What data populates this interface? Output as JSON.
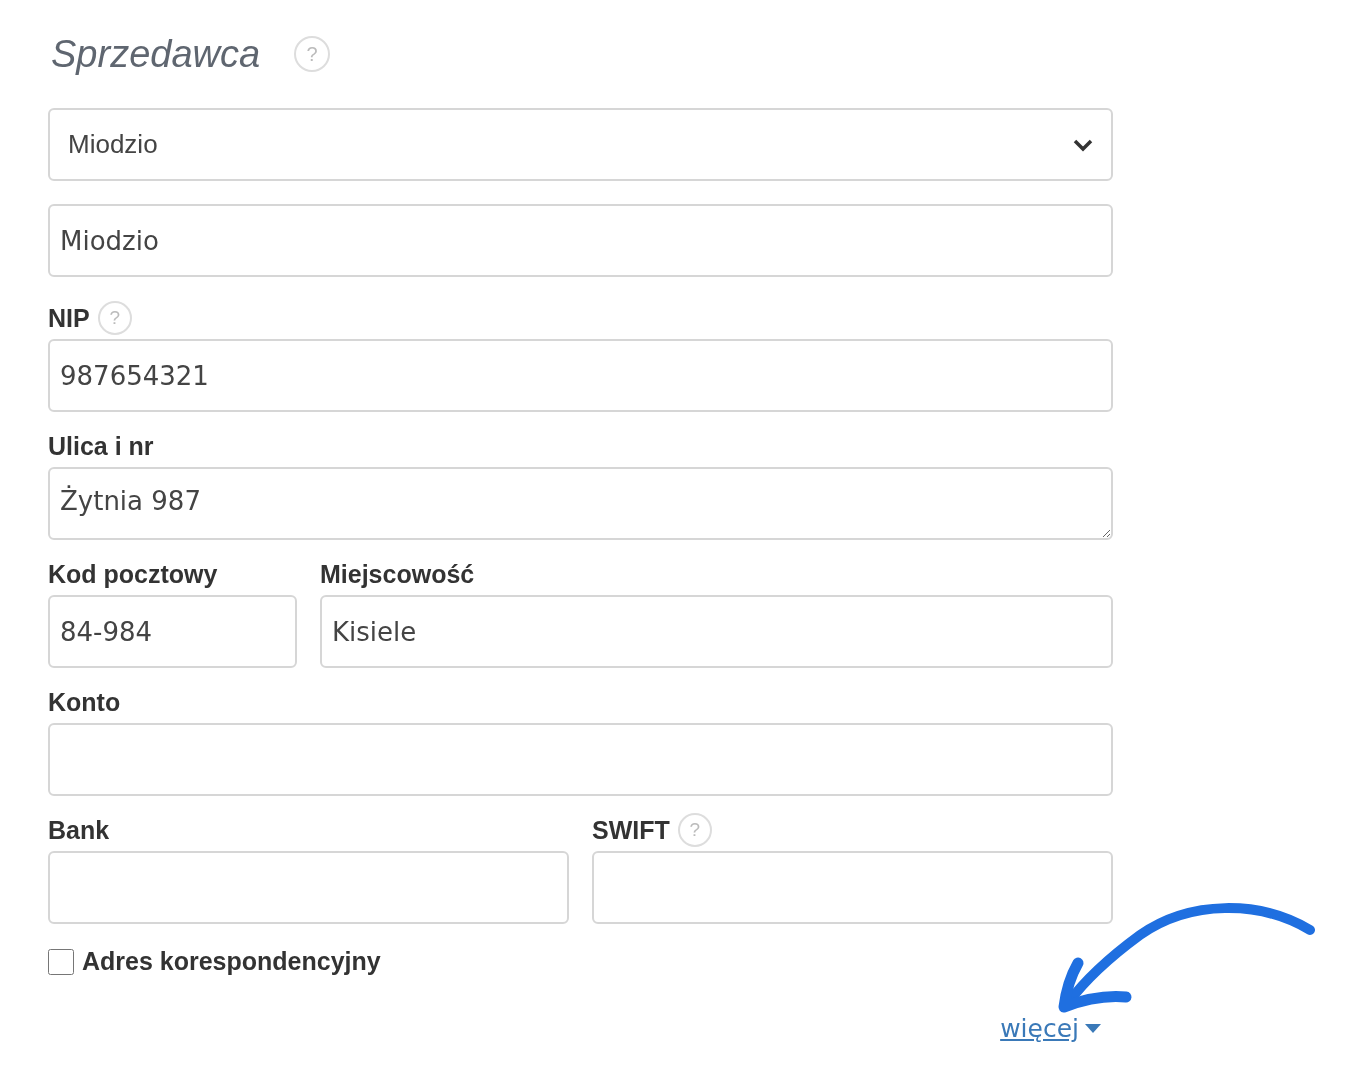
{
  "title": {
    "text": "Sprzedawca",
    "help": "?"
  },
  "seller_select": {
    "value": "Miodzio"
  },
  "name_field": {
    "value": "Miodzio"
  },
  "rows": [
    [
      {
        "label": "NIP",
        "help": "?",
        "kind": "input",
        "value": "987654321"
      }
    ],
    [
      {
        "label": "Ulica i nr",
        "kind": "textarea",
        "value": "Żytnia 987"
      }
    ],
    [
      {
        "label": "Kod pocztowy",
        "kind": "input",
        "value": "84-984",
        "narrow": true
      },
      {
        "label": "Miejscowość",
        "kind": "input",
        "value": "Kisiele",
        "narrow": false
      }
    ],
    [
      {
        "label": "Konto",
        "kind": "input"
      }
    ],
    [
      {
        "label": "Bank",
        "kind": "input"
      },
      {
        "label": "SWIFT",
        "help": "?",
        "kind": "input"
      }
    ]
  ],
  "checkbox": {
    "label": "Adres korespondencyjny",
    "checked": false
  },
  "more_link": {
    "label": "więcej"
  }
}
